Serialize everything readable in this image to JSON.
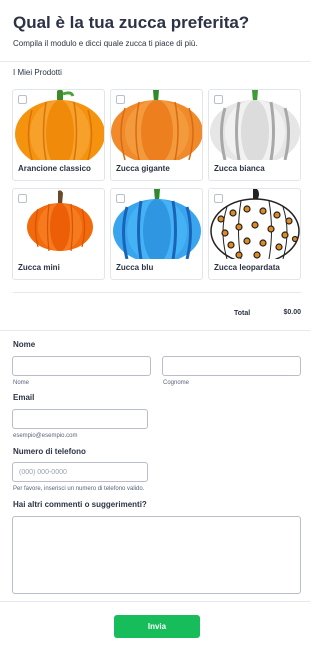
{
  "header": {
    "title": "Qual è la tua zucca preferita?",
    "subtitle": "Compila il modulo e dicci quale zucca ti piace di più."
  },
  "products": {
    "label": "I Miei Prodotti",
    "items": [
      {
        "name": "Arancione classico",
        "color": "#f5930f"
      },
      {
        "name": "Zucca gigante",
        "color": "#f08a2b"
      },
      {
        "name": "Zucca bianca",
        "color": "#d8d8d8"
      },
      {
        "name": "Zucca mini",
        "color": "#f26a0c"
      },
      {
        "name": "Zucca blu",
        "color": "#2f9be8"
      },
      {
        "name": "Zucca leopardata",
        "color": "#ffffff"
      }
    ],
    "total_label": "Total",
    "total_value": "$0.00"
  },
  "form": {
    "name_label": "Nome",
    "first_sublabel": "Nome",
    "last_sublabel": "Cognome",
    "email_label": "Email",
    "email_sublabel": "esempio@esempio.com",
    "phone_label": "Numero di telefono",
    "phone_placeholder": "(000) 000-0000",
    "phone_sublabel": "Per favore, inserisci un numero di telefono valido.",
    "comments_label": "Hai altri commenti o suggerimenti?",
    "submit_label": "Invia"
  },
  "colors": {
    "accent": "#18bd5b",
    "text": "#2c3345"
  }
}
